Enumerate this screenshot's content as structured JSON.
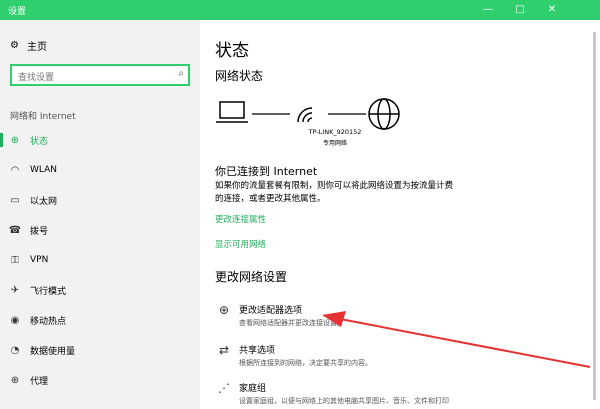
{
  "window": {
    "title": "设置",
    "min": "—",
    "max": "□",
    "close": "✕"
  },
  "sidebar": {
    "home_label": "主页",
    "search_placeholder": "查找设置",
    "section_label": "网络和 Internet",
    "items": [
      {
        "label": "状态",
        "icon": "globe-status-icon",
        "active": true
      },
      {
        "label": "WLAN",
        "icon": "wifi-icon",
        "active": false
      },
      {
        "label": "以太网",
        "icon": "ethernet-icon",
        "active": false
      },
      {
        "label": "拨号",
        "icon": "dialup-icon",
        "active": false
      },
      {
        "label": "VPN",
        "icon": "vpn-icon",
        "active": false
      },
      {
        "label": "飞行模式",
        "icon": "airplane-icon",
        "active": false
      },
      {
        "label": "移动热点",
        "icon": "hotspot-icon",
        "active": false
      },
      {
        "label": "数据使用量",
        "icon": "data-usage-icon",
        "active": false
      },
      {
        "label": "代理",
        "icon": "proxy-icon",
        "active": false
      }
    ]
  },
  "main": {
    "title": "状态",
    "network_status_heading": "网络状态",
    "network_name": "TP-LINK_920152",
    "network_type": "专用网络",
    "connected_title": "你已连接到 Internet",
    "connected_desc": "如果你的流量套餐有限制，则你可以将此网络设置为按流量计费的连接，或者更改其他属性。",
    "link_change_props": "更改连接属性",
    "link_show_networks": "显示可用网络",
    "change_settings_heading": "更改网络设置",
    "options": [
      {
        "title": "更改适配器选项",
        "subtitle": "查看网络适配器并更改连接设置。",
        "icon": "adapter-icon"
      },
      {
        "title": "共享选项",
        "subtitle": "根据所连接到的网络，决定要共享的内容。",
        "icon": "share-icon"
      },
      {
        "title": "家庭组",
        "subtitle": "设置家庭组，以便与网络上的其他电脑共享图片、音乐、文件和打印",
        "icon": "homegroup-icon"
      }
    ]
  },
  "colors": {
    "accent": "#1fae5b",
    "titlebar": "#2fcf6e",
    "annotation_arrow": "#e63232"
  }
}
